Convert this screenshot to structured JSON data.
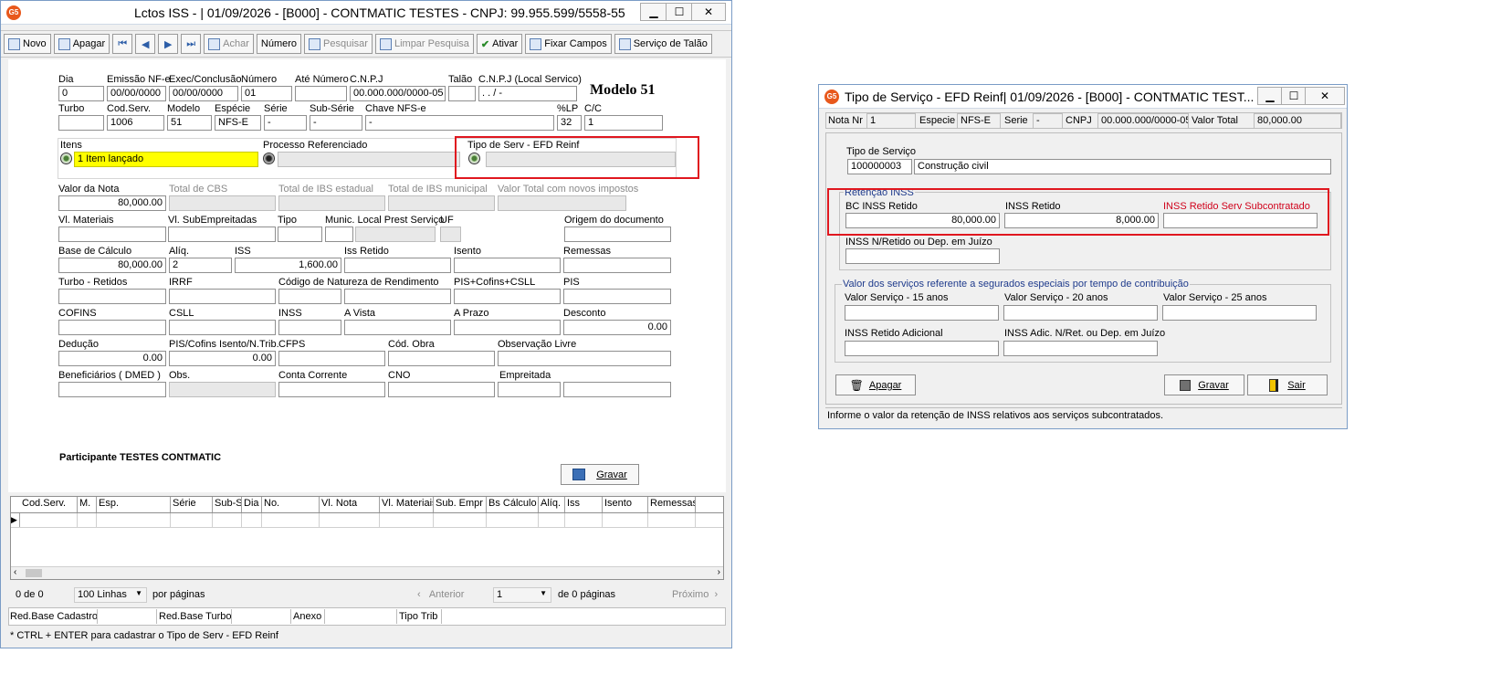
{
  "main": {
    "title": "Lctos ISS - |  01/09/2026 - [B000] - CONTMATIC  TESTES - CNPJ: 99.955.599/5558-55",
    "toolbar": {
      "novo": "Novo",
      "apagar": "Apagar",
      "achar": "Achar",
      "numero": "Número",
      "pesquisar": "Pesquisar",
      "limpar": "Limpar Pesquisa",
      "ativar": "Ativar",
      "fixar": "Fixar Campos",
      "servico_talao": "Serviço de Talão"
    },
    "modelo": "Modelo 51",
    "labels": {
      "dia": "Dia",
      "emissao": "Emissão NF-e",
      "exec": "Exec/Conclusão",
      "numero": "Número",
      "ate_numero": "Até Número",
      "cnpj": "C.N.P.J",
      "talao": "Talão",
      "cnpj_local": "C.N.P.J (Local Servico)",
      "turbo": "Turbo",
      "cod_serv": "Cod.Serv.",
      "modelo": "Modelo",
      "especie": "Espécie",
      "serie": "Série",
      "sub_serie": "Sub-Série",
      "chave": "Chave NFS-e",
      "lp": "%LP",
      "cc": "C/C",
      "itens": "Itens",
      "processo": "Processo Referenciado",
      "tipo_serv": "Tipo de Serv - EFD Reinf",
      "valor_nota": "Valor da Nota",
      "total_cbs": "Total de CBS",
      "total_ibs_est": "Total de IBS estadual",
      "total_ibs_mun": "Total de IBS municipal",
      "valor_total_novos": "Valor Total com novos impostos",
      "vl_materiais": "Vl. Materiais",
      "vl_subemp": "Vl. SubEmpreitadas",
      "tipo": "Tipo",
      "munic": "Munic. Local Prest Serviço",
      "uf": "UF",
      "origem": "Origem do documento",
      "base_calc": "Base de Cálculo",
      "aliq": "Alíq.",
      "iss": "ISS",
      "iss_retido": "Iss Retido",
      "isento": "Isento",
      "remessas": "Remessas",
      "turbo_retidos": "Turbo - Retidos",
      "irrf": "IRRF",
      "cod_natureza": "Código de Natureza de Rendimento",
      "pis_cofins_csll": "PIS+Cofins+CSLL",
      "pis": "PIS",
      "cofins": "COFINS",
      "csll": "CSLL",
      "inss": "INSS",
      "a_vista": "A Vista",
      "a_prazo": "A Prazo",
      "desconto": "Desconto",
      "deducao": "Dedução",
      "pis_cofins_isento": "PIS/Cofins Isento/N.Trib.",
      "cfps": "CFPS",
      "cod_obra": "Cód. Obra",
      "obs_livre": "Observação Livre",
      "beneficiarios": "Beneficiários ( DMED )",
      "obs": "Obs.",
      "conta_corrente": "Conta Corrente",
      "cno": "CNO",
      "empreitada": "Empreitada"
    },
    "values": {
      "dia": "0",
      "emissao": "00/00/0000",
      "exec": "00/00/0000",
      "numero": "01",
      "cnpj": "00.000.000/0000-05",
      "cnpj_local": "  .   .   /   -",
      "cod_serv": "1006",
      "modelo": "51",
      "especie": "NFS-E",
      "serie": "-",
      "sub_serie": "-",
      "chave": "-",
      "lp": "32",
      "cc": "1",
      "itens": "1 Item lançado",
      "valor_nota": "80,000.00",
      "base_calc": "80,000.00",
      "aliq": "2",
      "iss": "1,600.00",
      "desconto": "0.00",
      "deducao": "0.00",
      "pis_cofins_isento": "0.00"
    },
    "participante": "Participante TESTES CONTMATIC",
    "gravar": "Gravar",
    "grid_headers": [
      "Cod.Serv.",
      "M.",
      "Esp.",
      "Série",
      "Sub-S",
      "Dia",
      "No.",
      "Vl. Nota",
      "Vl. Materiais",
      "Sub. Empr",
      "Bs Cálculo",
      "Alíq.",
      "Iss",
      "Isento",
      "Remessas"
    ],
    "pager": {
      "count": "0   de   0",
      "lines": "100 Linhas",
      "per_page": "por páginas",
      "anterior": "Anterior",
      "page": "1",
      "of_pages": "de 0 páginas",
      "proximo": "Próximo"
    },
    "bottom": {
      "red_base_cadastro": "Red.Base Cadastro",
      "red_base_turbo": "Red.Base Turbo",
      "anexo": "Anexo",
      "tipo_trib": "Tipo Trib"
    },
    "status": "* CTRL + ENTER para  cadastrar o Tipo de Serv - EFD Reinf"
  },
  "dialog": {
    "title": "Tipo de Serviço - EFD Reinf|  01/09/2026 - [B000] - CONTMATIC  TEST...",
    "header": {
      "nota_nr": "Nota Nr",
      "nota_nr_val": "1",
      "especie": "Especie",
      "especie_val": "NFS-E",
      "serie": "Serie",
      "serie_val": "-",
      "cnpj": "CNPJ",
      "cnpj_val": "00.000.000/0000-05",
      "valor_total": "Valor Total",
      "valor_total_val": "80,000.00"
    },
    "tipo_servico_label": "Tipo de Serviço",
    "tipo_servico_code": "100000003",
    "tipo_servico_desc": "Construção civil",
    "retencao_title": "Retenção INSS",
    "bc_inss_label": "BC INSS Retido",
    "bc_inss_val": "80,000.00",
    "inss_retido_label": "INSS Retido",
    "inss_retido_val": "8,000.00",
    "inss_sub_label": "INSS Retido Serv Subcontratado",
    "inss_nret_label": "INSS N/Retido ou Dep. em Juízo",
    "valor_servicos_title": "Valor dos serviços referente a segurados especiais por tempo de contribuição",
    "vs15": "Valor Serviço - 15 anos",
    "vs20": "Valor Serviço - 20 anos",
    "vs25": "Valor Serviço - 25 anos",
    "inss_adicional": "INSS Retido Adicional",
    "inss_adic_nret": "INSS Adic. N/Ret. ou Dep. em Juízo",
    "apagar": "Apagar",
    "gravar": "Gravar",
    "sair": "Sair",
    "status": "Informe o valor da retenção de INSS relativos aos serviços subcontratados."
  }
}
